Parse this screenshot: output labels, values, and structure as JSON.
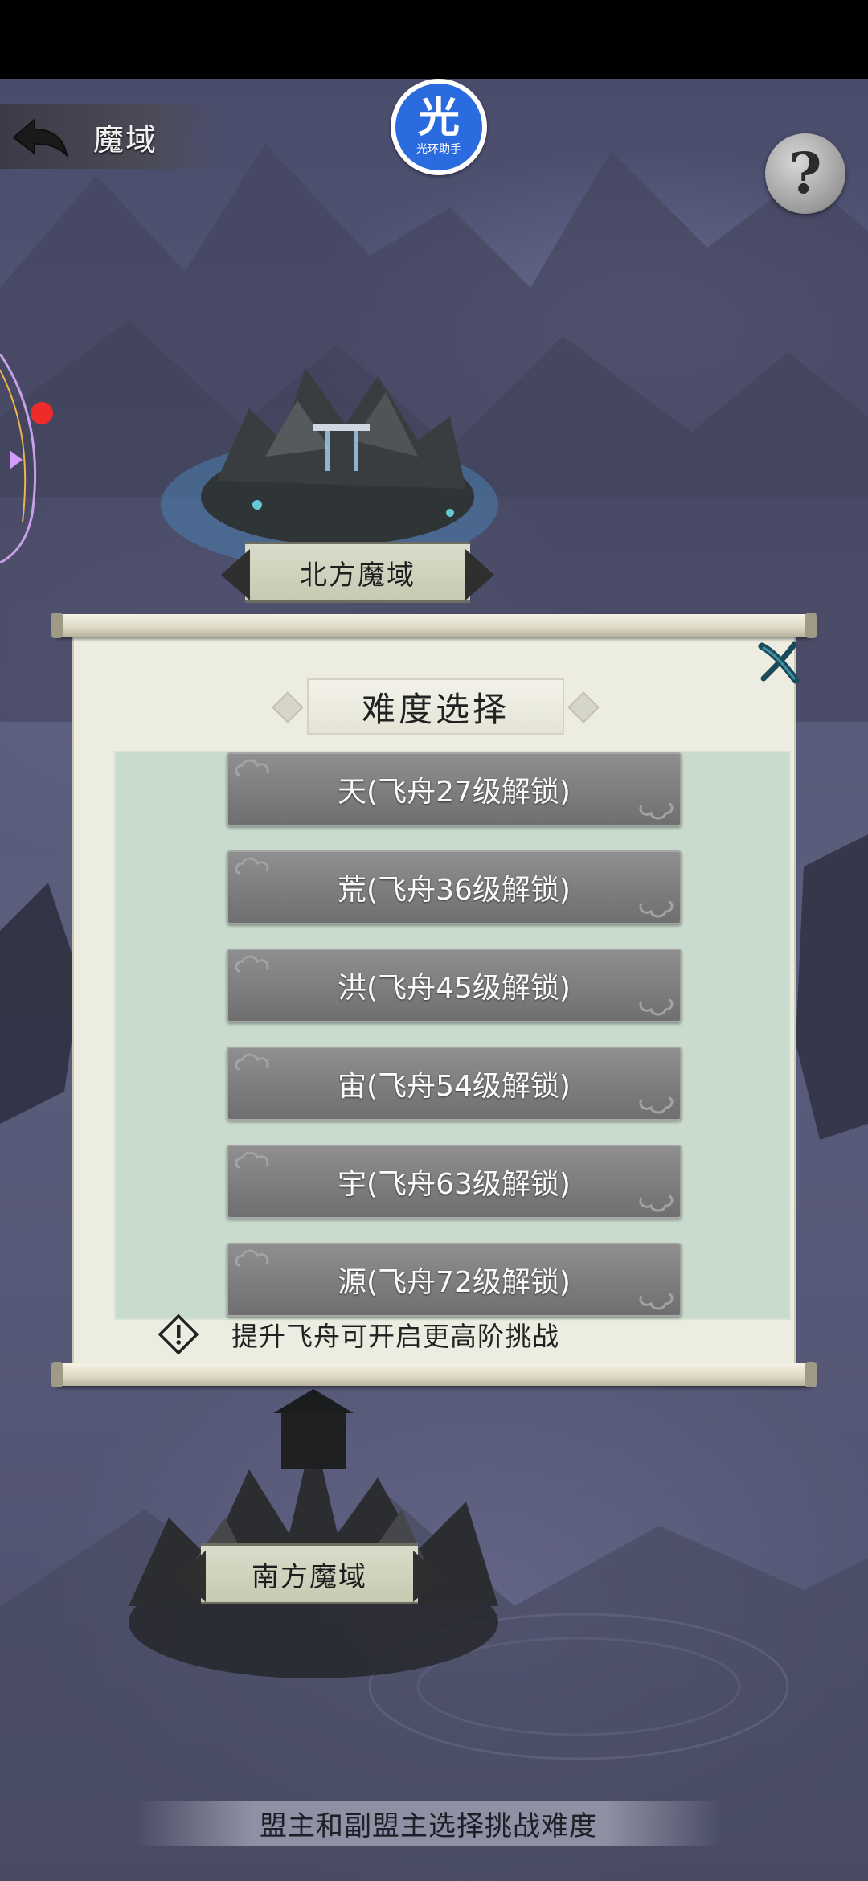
{
  "header": {
    "back_label": "魔域",
    "halo_glyph": "光",
    "halo_text": "光环助手",
    "help_glyph": "?"
  },
  "map": {
    "north_label": "北方魔域",
    "south_label": "南方魔域"
  },
  "dialog": {
    "title": "难度选择",
    "options": [
      {
        "label": "天(飞舟27级解锁)"
      },
      {
        "label": "荒(飞舟36级解锁)"
      },
      {
        "label": "洪(飞舟45级解锁)"
      },
      {
        "label": "宙(飞舟54级解锁)"
      },
      {
        "label": "宇(飞舟63级解锁)"
      },
      {
        "label": "源(飞舟72级解锁)"
      }
    ],
    "hint": "提升飞舟可开启更高阶挑战"
  },
  "footer": {
    "text": "盟主和副盟主选择挑战难度"
  },
  "colors": {
    "background": "#545676",
    "badge_blue": "#2b6be0",
    "option_gray": "#7d7d7d",
    "panel_green": "#c8dbcc",
    "notification_red": "#ee2a2a"
  }
}
